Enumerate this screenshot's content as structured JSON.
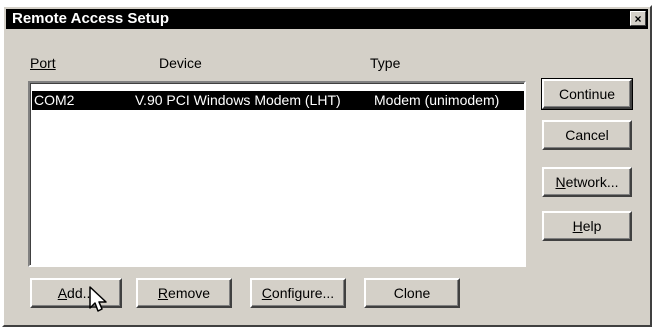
{
  "window": {
    "title": "Remote Access Setup",
    "close_glyph": "×"
  },
  "list": {
    "columns": [
      "Port",
      "Device",
      "Type"
    ],
    "rows": [
      {
        "port": "COM2",
        "device": "V.90 PCI Windows Modem (LHT)",
        "type": "Modem (unimodem)",
        "selected": true
      }
    ]
  },
  "buttons": {
    "continue": "Continue",
    "cancel": "Cancel",
    "network": {
      "accel": "N",
      "rest": "etwork..."
    },
    "help": {
      "accel": "H",
      "rest": "elp"
    },
    "add": {
      "accel": "A",
      "rest": "dd..."
    },
    "remove": {
      "accel": "R",
      "rest": "emove"
    },
    "configure": {
      "accel": "C",
      "rest": "onfigure..."
    },
    "clone": "Clone"
  },
  "icons": {
    "close": "close-icon",
    "pointer": "mouse-pointer-icon"
  },
  "colors": {
    "face": "#d4d0c8",
    "titlebar": "#000000",
    "selection": "#000000"
  }
}
